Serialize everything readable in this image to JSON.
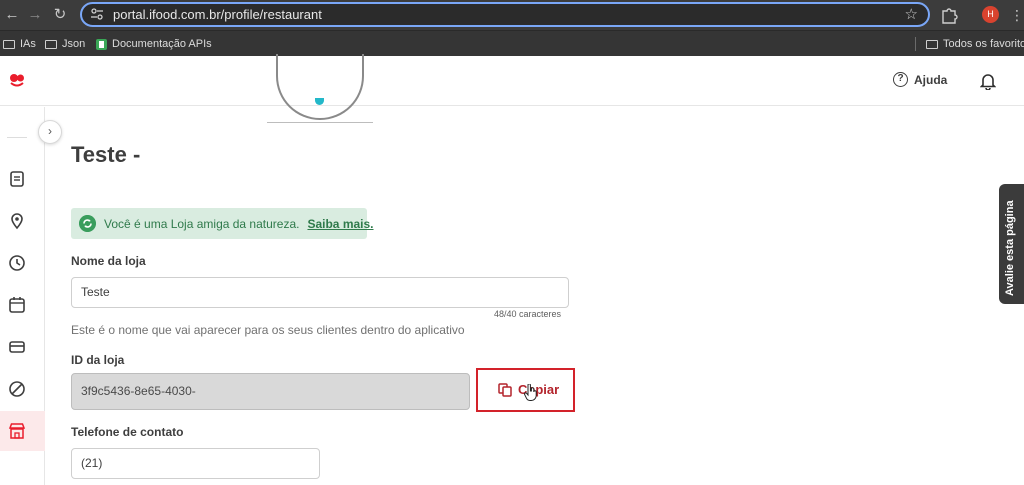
{
  "browser": {
    "url": "portal.ifood.com.br/profile/restaurant",
    "profile_initial": "H",
    "bookmarks": [
      {
        "label": "IAs",
        "icon": "folder-icon"
      },
      {
        "label": "Json",
        "icon": "folder-icon"
      },
      {
        "label": "Documentação APIs",
        "icon": "docs-icon"
      }
    ],
    "all_bookmarks_label": "Todos os favoritos"
  },
  "header": {
    "help_label": "Ajuda"
  },
  "colors": {
    "brand_red": "#ea1d2c",
    "eco_green": "#2f7a4b",
    "highlight_red": "#d3222a"
  },
  "store": {
    "title": "Teste -",
    "eco_message": "Você é uma Loja amiga da natureza.",
    "eco_link": "Saiba mais."
  },
  "form": {
    "name_label": "Nome da loja",
    "name_value": "Teste",
    "name_counter": "48/40 caracteres",
    "name_helper": "Este é o nome que vai aparecer para os seus clientes dentro do aplicativo",
    "id_label": "ID da loja",
    "id_value": "3f9c5436-8e65-4030-",
    "copy_label": "Copiar",
    "phone_label": "Telefone de contato",
    "phone_value": "(21)"
  },
  "feedback_tab": {
    "label": "Avalie esta página"
  }
}
